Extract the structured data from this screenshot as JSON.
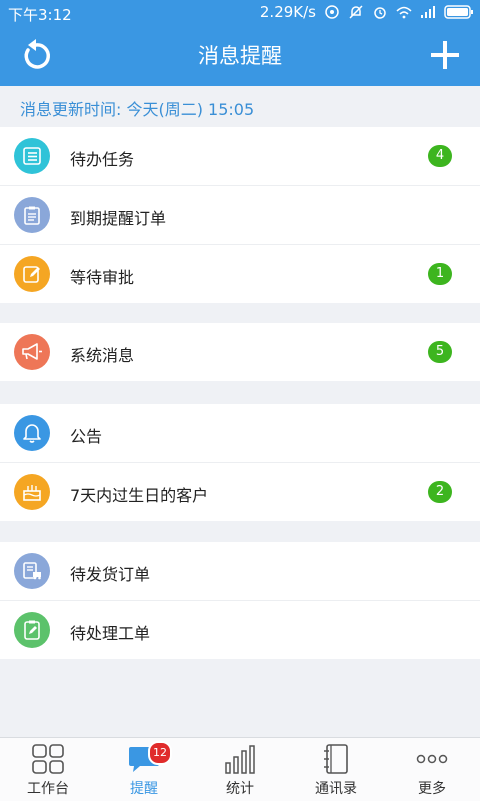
{
  "status_bar": {
    "time": "下午3:12",
    "network_speed": "2.29K/s"
  },
  "header": {
    "title": "消息提醒"
  },
  "updated": {
    "label": "消息更新时间: 今天(周二) 15:05"
  },
  "groups": [
    [
      {
        "label": "待办任务",
        "badge": "4",
        "icon": "task-list-icon",
        "color": "#2fc3d8"
      },
      {
        "label": "到期提醒订单",
        "badge": "",
        "icon": "clipboard-icon",
        "color": "#8aa7d9"
      },
      {
        "label": "等待审批",
        "badge": "1",
        "icon": "edit-icon",
        "color": "#f5a623"
      }
    ],
    [
      {
        "label": "系统消息",
        "badge": "5",
        "icon": "megaphone-icon",
        "color": "#ee7657"
      }
    ],
    [
      {
        "label": "公告",
        "badge": "",
        "icon": "bell-icon",
        "color": "#3a97e3"
      },
      {
        "label": "7天内过生日的客户",
        "badge": "2",
        "icon": "cake-icon",
        "color": "#f5a623"
      }
    ],
    [
      {
        "label": "待发货订单",
        "badge": "",
        "icon": "delivery-icon",
        "color": "#8aa7d9"
      },
      {
        "label": "待处理工单",
        "badge": "",
        "icon": "work-order-icon",
        "color": "#5cc26b"
      }
    ]
  ],
  "tabs": [
    {
      "label": "工作台",
      "icon": "grid-icon"
    },
    {
      "label": "提醒",
      "icon": "chat-bubble-icon",
      "badge": "12"
    },
    {
      "label": "统计",
      "icon": "bar-chart-icon"
    },
    {
      "label": "通讯录",
      "icon": "notebook-icon"
    },
    {
      "label": "更多",
      "icon": "more-dots-icon"
    }
  ],
  "colors": {
    "primary": "#3a97e3",
    "badge_green": "#3db51f",
    "badge_red": "#e02b2b"
  }
}
